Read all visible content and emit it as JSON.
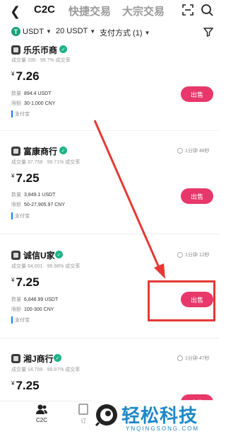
{
  "topbar": {
    "tabs": [
      {
        "label": "C2C",
        "active": true
      },
      {
        "label": "快捷交易",
        "active": false
      },
      {
        "label": "大宗交易",
        "active": false
      }
    ]
  },
  "filters": {
    "coin": "USDT",
    "amount": "20 USDT",
    "payment": "支付方式 (1)"
  },
  "labels": {
    "qty": "数量",
    "limit": "限额",
    "sell": "出售"
  },
  "merchants": [
    {
      "name": "乐乐币商",
      "stats": "成交量 335 · 99.7% 成交率",
      "online": "",
      "price": "7.26",
      "quantity": "894.4 USDT",
      "limit": "30-1,000 CNY",
      "payment": "支付宝"
    },
    {
      "name": "富康商行",
      "stats": "成交量 37,758 · 99.71% 成交率",
      "online": "1分钟 48秒",
      "price": "7.25",
      "quantity": "3,849.1 USDT",
      "limit": "50-27,905.97 CNY",
      "payment": "支付宝"
    },
    {
      "name": "诚信U家",
      "stats": "成交量 64,001 · 99.98% 成交率",
      "online": "1分钟 12秒",
      "price": "7.25",
      "quantity": "6,846.99 USDT",
      "limit": "100-300 CNY",
      "payment": "支付宝"
    },
    {
      "name": "湘J商行",
      "stats": "成交量 14,709 · 99.97% 成交率",
      "online": "1分钟 47秒",
      "price": "7.25",
      "quantity": "",
      "limit": "",
      "payment": ""
    }
  ],
  "bottom_nav": {
    "c2c": "C2C",
    "order": "订"
  },
  "watermark": {
    "title": "轻松科技",
    "url": "YNQINGSONG.COM"
  },
  "colors": {
    "sell_button": "#e8376a",
    "annotation_red": "#e53935",
    "verified_green": "#1bb386",
    "watermark_blue": "#1e88c7"
  }
}
